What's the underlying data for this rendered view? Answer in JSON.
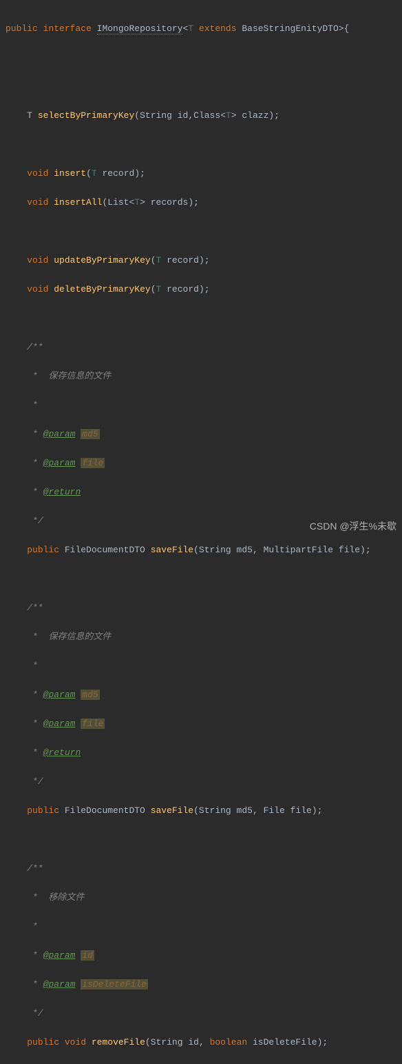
{
  "code": {
    "decl_public": "public",
    "decl_interface": "interface",
    "iface_name": "IMongoRepository",
    "generic_open": "<",
    "generic_T": "T",
    "extends_kw": "extends",
    "base_type": "BaseStringEnityDTO",
    "generic_close": ">",
    "brace_open": "{",
    "selectByPK": "selectByPrimaryKey",
    "string_type": "String",
    "id_param": "id",
    "class_type": "Class",
    "clazz_param": "clazz",
    "semi": ";",
    "comma": ",",
    "paren_open": "(",
    "paren_close": ")",
    "void_kw": "void",
    "insert": "insert",
    "record_param": "record",
    "insertAll": "insertAll",
    "list_type": "List",
    "records_param": "records",
    "updateByPK": "updateByPrimaryKey",
    "deleteByPK": "deleteByPrimaryKey",
    "doc_open": "/**",
    "doc_star": " *",
    "doc_close": " */",
    "doc_save": " *  保存信息的文件",
    "doc_remove": " *  移除文件",
    "tag_param": "@param",
    "p_md5": "md5",
    "p_file": "file",
    "p_id": "id",
    "p_isDeleteFile": "isDeleteFile",
    "tag_return": "@return",
    "public_kw": "public",
    "FileDocumentDTO": "FileDocumentDTO",
    "saveFile": "saveFile",
    "MultipartFile": "MultipartFile",
    "File": "File",
    "removeFile": "removeFile",
    "boolean_kw": "boolean",
    "isDeleteFile_param": "isDeleteFile"
  },
  "watermark": "CSDN @浮生%未歇"
}
